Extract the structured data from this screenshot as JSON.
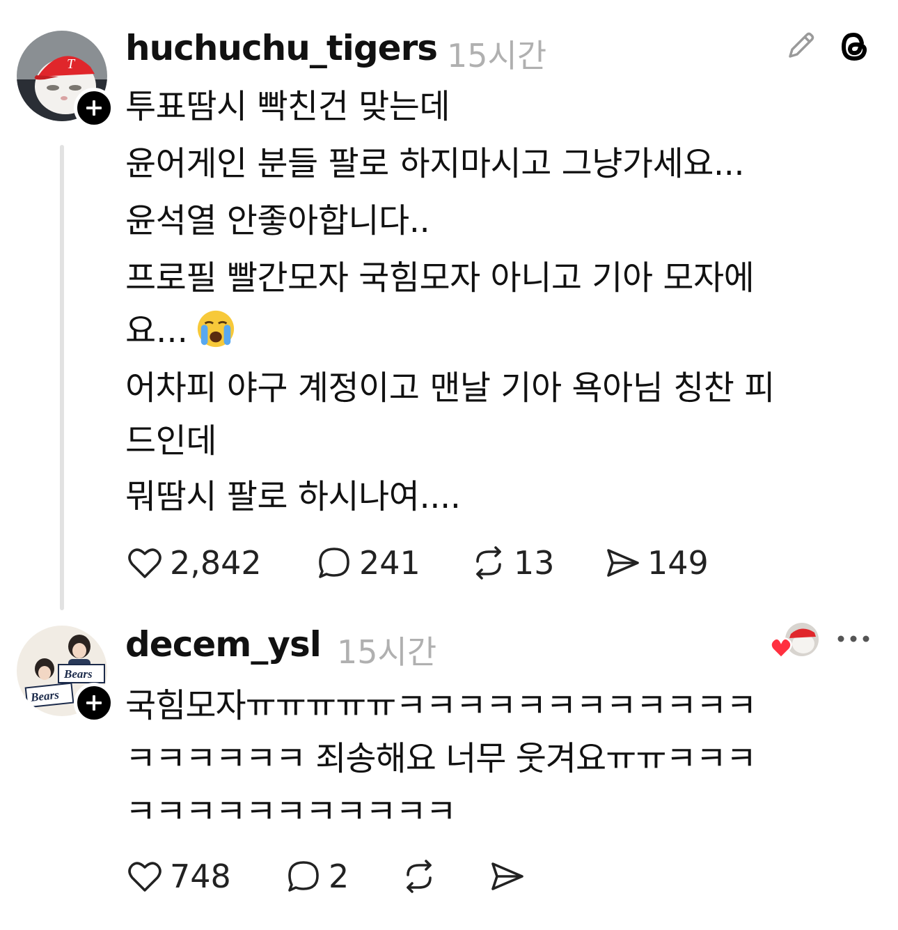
{
  "posts": [
    {
      "username": "huchuchu_tigers",
      "time": "15시간",
      "lines": [
        "투표땀시 빡친건 맞는데",
        "윤어게인 분들 팔로 하지마시고 그냥가세요...",
        "윤석열 안좋아합니다..",
        "프로필 빨간모자 국힘모자 아니고 기아 모자에",
        "요...",
        "어차피 야구 계정이고 맨날 기아 욕아님 칭찬 피",
        "드인데",
        "뭐땀시 팔로 하시나여...."
      ],
      "avatar_icon": "cat-red-cap-avatar",
      "top_right_icons": [
        "pencil-icon",
        "threads-logo-icon"
      ],
      "actions": {
        "likes": "2,842",
        "replies": "241",
        "reposts": "13",
        "shares": "149"
      }
    },
    {
      "username": "decem_ysl",
      "time": "15시간",
      "lines": [
        "국힘모자ㅠㅠㅠㅠㅠㅋㅋㅋㅋㅋㅋㅋㅋㅋㅋㅋㅋ",
        "ㅋㅋㅋㅋㅋㅋ 죄송해요 너무 웃겨요ㅠㅠㅋㅋㅋ",
        "ㅋㅋㅋㅋㅋㅋㅋㅋㅋㅋㅋ"
      ],
      "avatar_icon": "bears-fans-avatar",
      "top_right_icons": [
        "liked-by-author-icon",
        "more-icon"
      ],
      "actions": {
        "likes": "748",
        "replies": "2",
        "reposts": "",
        "shares": ""
      }
    }
  ],
  "colors": {
    "text": "#111111",
    "muted": "#b0b0b0",
    "thread_line": "#e2e2e2",
    "heart_red": "#ff3040"
  }
}
